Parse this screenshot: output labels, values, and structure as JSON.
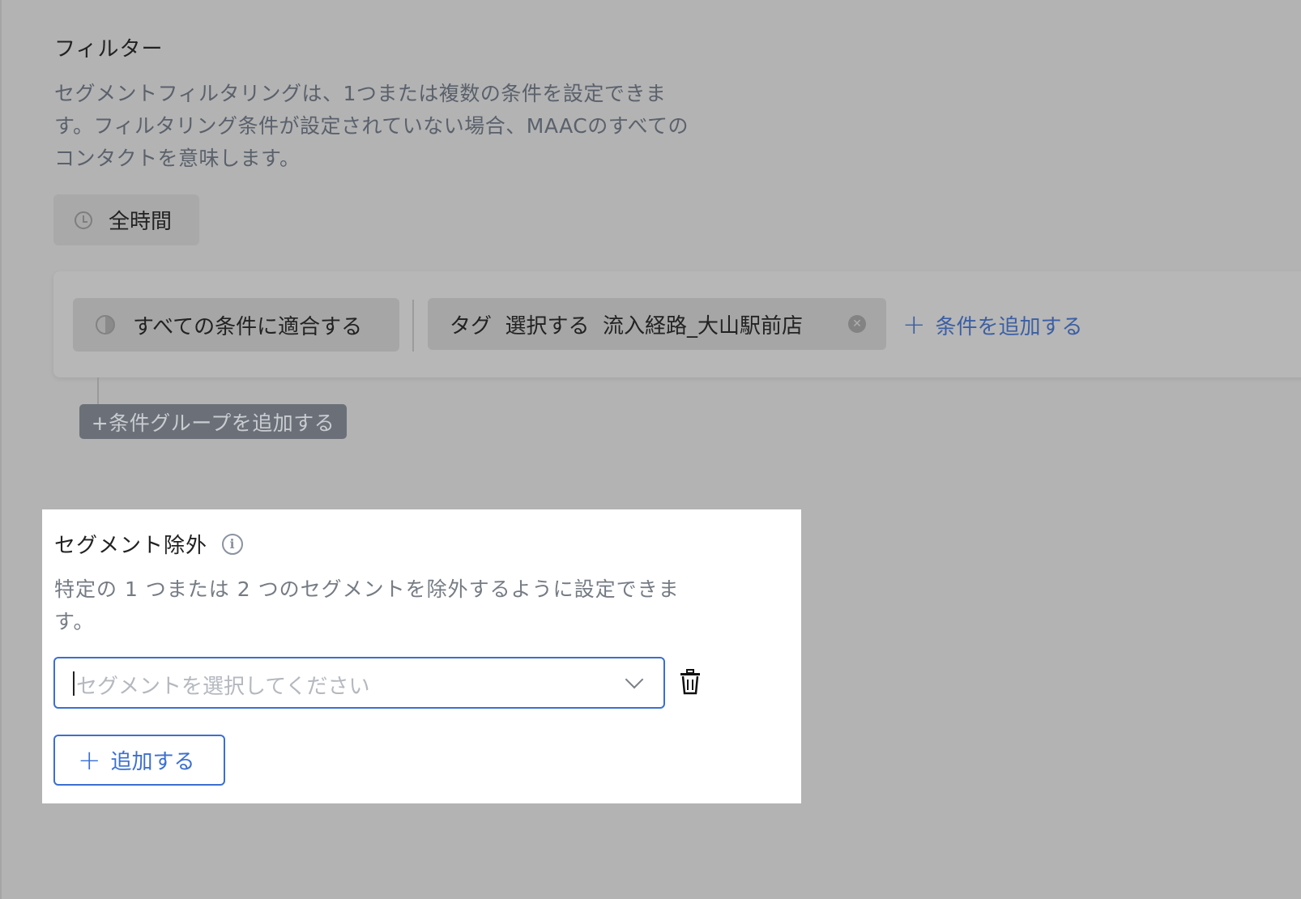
{
  "filter": {
    "title": "フィルター",
    "description": "セグメントフィルタリングは、1つまたは複数の条件を設定できます。フィルタリング条件が設定されていない場合、MAACのすべてのコンタクトを意味します。",
    "time_chip": "全時間",
    "match_chip": "すべての条件に適合する",
    "tag_chip": "タグ  選択する  流入経路_大山駅前店",
    "add_condition": "条件を追加する",
    "add_group": "+条件グループを追加する"
  },
  "exclusion": {
    "title": "セグメント除外",
    "description": "特定の 1 つまたは 2 つのセグメントを除外するように設定できます。",
    "select_placeholder": "セグメントを選択してください",
    "add_button": "追加する"
  },
  "colors": {
    "accent": "#3b6fd1",
    "overlay": "#b3b3b3"
  }
}
